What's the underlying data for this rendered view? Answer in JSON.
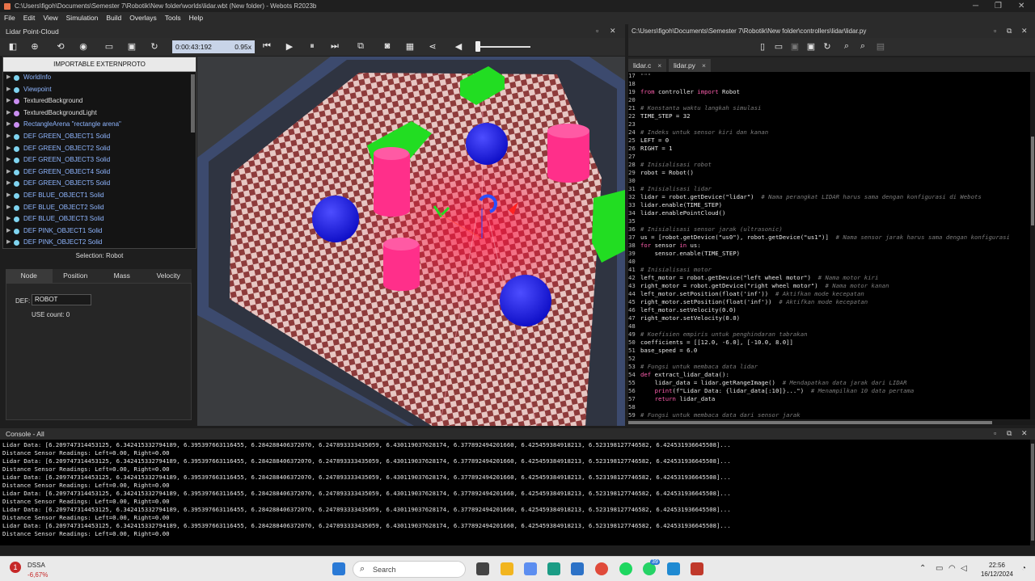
{
  "window": {
    "title": "C:\\Users\\figoh\\Documents\\Semester 7\\Robotik\\New folder\\worlds\\lidar.wbt (New folder) - Webots R2023b"
  },
  "menu": [
    "File",
    "Edit",
    "View",
    "Simulation",
    "Build",
    "Overlays",
    "Tools",
    "Help"
  ],
  "left_panel": {
    "title": "Lidar Point-Cloud",
    "time": "0:00:43:192",
    "speed": "0.95x"
  },
  "scene_tree": {
    "header": "IMPORTABLE EXTERNPROTO",
    "items": [
      {
        "label": "WorldInfo",
        "dot": "#7fd4f0",
        "blue": true
      },
      {
        "label": "Viewpoint",
        "dot": "#7fd4f0",
        "blue": true
      },
      {
        "label": "TexturedBackground",
        "dot": "#c98ef0",
        "blue": false
      },
      {
        "label": "TexturedBackgroundLight",
        "dot": "#c98ef0",
        "blue": false
      },
      {
        "label": "RectangleArena \"rectangle arena\"",
        "dot": "#c98ef0",
        "blue": true
      },
      {
        "label": "DEF GREEN_OBJECT1 Solid",
        "dot": "#7fd4f0",
        "blue": true
      },
      {
        "label": "DEF GREEN_OBJECT2 Solid",
        "dot": "#7fd4f0",
        "blue": true
      },
      {
        "label": "DEF GREEN_OBJECT3 Solid",
        "dot": "#7fd4f0",
        "blue": true
      },
      {
        "label": "DEF GREEN_OBJECT4 Solid",
        "dot": "#7fd4f0",
        "blue": true
      },
      {
        "label": "DEF GREEN_OBJECT5 Solid",
        "dot": "#7fd4f0",
        "blue": true
      },
      {
        "label": "DEF BLUE_OBJECT1 Solid",
        "dot": "#7fd4f0",
        "blue": true
      },
      {
        "label": "DEF BLUE_OBJECT2 Solid",
        "dot": "#7fd4f0",
        "blue": true
      },
      {
        "label": "DEF BLUE_OBJECT3 Solid",
        "dot": "#7fd4f0",
        "blue": true
      },
      {
        "label": "DEF PINK_OBJECT1 Solid",
        "dot": "#7fd4f0",
        "blue": true
      },
      {
        "label": "DEF PINK_OBJECT2 Solid",
        "dot": "#7fd4f0",
        "blue": true
      }
    ]
  },
  "node_panel": {
    "selection": "Selection: Robot",
    "tabs": [
      "Node",
      "Position",
      "Mass",
      "Velocity"
    ],
    "def_label": "DEF:",
    "def_value": "ROBOT",
    "use_count": "USE count: 0"
  },
  "editor": {
    "path": "C:\\Users\\figoh\\Documents\\Semester 7\\Robotik\\New folder\\controllers\\lidar\\lidar.py",
    "tabs": [
      "lidar.c",
      "lidar.py"
    ],
    "close_glyph": "×",
    "lines": [
      {
        "n": "17",
        "t": "\"\"\"",
        "k": "cm"
      },
      {
        "n": "18",
        "t": "",
        "k": ""
      },
      {
        "n": "19",
        "t": "from controller import Robot",
        "k": "imp"
      },
      {
        "n": "20",
        "t": "",
        "k": ""
      },
      {
        "n": "21",
        "t": "# Konstanta waktu langkah simulasi",
        "k": "cm"
      },
      {
        "n": "22",
        "t": "TIME_STEP = 32",
        "k": ""
      },
      {
        "n": "23",
        "t": "",
        "k": ""
      },
      {
        "n": "24",
        "t": "# Indeks untuk sensor kiri dan kanan",
        "k": "cm"
      },
      {
        "n": "25",
        "t": "LEFT = 0",
        "k": ""
      },
      {
        "n": "26",
        "t": "RIGHT = 1",
        "k": ""
      },
      {
        "n": "27",
        "t": "",
        "k": ""
      },
      {
        "n": "28",
        "t": "# Inisialisasi robot",
        "k": "cm"
      },
      {
        "n": "29",
        "t": "robot = Robot()",
        "k": ""
      },
      {
        "n": "30",
        "t": "",
        "k": ""
      },
      {
        "n": "31",
        "t": "# Inisialisasi lidar",
        "k": "cm"
      },
      {
        "n": "32",
        "t": "lidar = robot.getDevice(\"lidar\")",
        "c": "  # Nama perangkat LIDAR harus sama dengan konfigurasi di Webots",
        "k": "mix"
      },
      {
        "n": "33",
        "t": "lidar.enable(TIME_STEP)",
        "k": ""
      },
      {
        "n": "34",
        "t": "lidar.enablePointCloud()",
        "k": ""
      },
      {
        "n": "35",
        "t": "",
        "k": ""
      },
      {
        "n": "36",
        "t": "# Inisialisasi sensor jarak (ultrasonic)",
        "k": "cm"
      },
      {
        "n": "37",
        "t": "us = [robot.getDevice(\"us0\"), robot.getDevice(\"us1\")]",
        "c": "  # Nama sensor jarak harus sama dengan konfigurasi",
        "k": "mix"
      },
      {
        "n": "38",
        "t": "for sensor in us:",
        "k": "for"
      },
      {
        "n": "39",
        "t": "    sensor.enable(TIME_STEP)",
        "k": ""
      },
      {
        "n": "40",
        "t": "",
        "k": ""
      },
      {
        "n": "41",
        "t": "# Inisialisasi motor",
        "k": "cm"
      },
      {
        "n": "42",
        "t": "left_motor = robot.getDevice(\"left wheel motor\")",
        "c": "  # Nama motor kiri",
        "k": "mix"
      },
      {
        "n": "43",
        "t": "right_motor = robot.getDevice(\"right wheel motor\")",
        "c": "  # Nama motor kanan",
        "k": "mix"
      },
      {
        "n": "44",
        "t": "left_motor.setPosition(float('inf'))",
        "c": "  # Aktifkan mode kecepatan",
        "k": "mix"
      },
      {
        "n": "45",
        "t": "right_motor.setPosition(float('inf'))",
        "c": "  # Aktifkan mode kecepatan",
        "k": "mix"
      },
      {
        "n": "46",
        "t": "left_motor.setVelocity(0.0)",
        "k": ""
      },
      {
        "n": "47",
        "t": "right_motor.setVelocity(0.0)",
        "k": ""
      },
      {
        "n": "48",
        "t": "",
        "k": ""
      },
      {
        "n": "49",
        "t": "# Koefisien empiris untuk penghindaran tabrakan",
        "k": "cm"
      },
      {
        "n": "50",
        "t": "coefficients = [[12.0, -6.0], [-10.0, 8.0]]",
        "k": ""
      },
      {
        "n": "51",
        "t": "base_speed = 6.0",
        "k": ""
      },
      {
        "n": "52",
        "t": "",
        "k": ""
      },
      {
        "n": "53",
        "t": "# Fungsi untuk membaca data lidar",
        "k": "cm"
      },
      {
        "n": "54",
        "t": "def extract_lidar_data():",
        "k": "def"
      },
      {
        "n": "55",
        "t": "    lidar_data = lidar.getRangeImage()",
        "c": "  # Mendapatkan data jarak dari LIDAR",
        "k": "mix"
      },
      {
        "n": "56",
        "t": "    print(f\"Lidar Data: {lidar_data[:10]}...\")",
        "c": "  # Menampilkan 10 data pertama",
        "k": "print"
      },
      {
        "n": "57",
        "t": "    return lidar_data",
        "k": "ret"
      },
      {
        "n": "58",
        "t": "",
        "k": ""
      },
      {
        "n": "59",
        "t": "# Fungsi untuk membaca data dari sensor jarak",
        "k": "cm"
      }
    ]
  },
  "console": {
    "title": "Console - All",
    "lines": [
      "Lidar Data: [6.209747314453125, 6.342415332794189, 6.395397663116455, 6.284288406372070, 6.247893333435059, 6.430119037628174, 6.377892494201660, 6.425459384918213, 6.523198127746582, 6.424531936645508]...",
      "Distance Sensor Readings: Left=0.00, Right=0.00",
      "Lidar Data: [6.209747314453125, 6.342415332794189, 6.395397663116455, 6.284288406372070, 6.247893333435059, 6.430119037628174, 6.377892494201660, 6.425459384918213, 6.523198127746582, 6.424531936645508]...",
      "Distance Sensor Readings: Left=0.00, Right=0.00",
      "Lidar Data: [6.209747314453125, 6.342415332794189, 6.395397663116455, 6.284288406372070, 6.247893333435059, 6.430119037628174, 6.377892494201660, 6.425459384918213, 6.523198127746582, 6.424531936645508]...",
      "Distance Sensor Readings: Left=0.00, Right=0.00",
      "Lidar Data: [6.209747314453125, 6.342415332794189, 6.395397663116455, 6.284288406372070, 6.247893333435059, 6.430119037628174, 6.377892494201660, 6.425459384918213, 6.523198127746582, 6.424531936645508]...",
      "Distance Sensor Readings: Left=0.00, Right=0.00",
      "Lidar Data: [6.209747314453125, 6.342415332794189, 6.395397663116455, 6.284288406372070, 6.247893333435059, 6.430119037628174, 6.377892494201660, 6.425459384918213, 6.523198127746582, 6.424531936645508]...",
      "Distance Sensor Readings: Left=0.00, Right=0.00",
      "Lidar Data: [6.209747314453125, 6.342415332794189, 6.395397663116455, 6.284288406372070, 6.247893333435059, 6.430119037628174, 6.377892494201660, 6.425459384918213, 6.523198127746582, 6.424531936645508]...",
      "Distance Sensor Readings: Left=0.00, Right=0.00"
    ]
  },
  "taskbar": {
    "weather_name": "DSSA",
    "weather_change": "-6,67%",
    "weather_badge": "1",
    "search_placeholder": "Search",
    "time": "22:56",
    "date": "16/12/2024",
    "whatsapp_badge": "39"
  }
}
